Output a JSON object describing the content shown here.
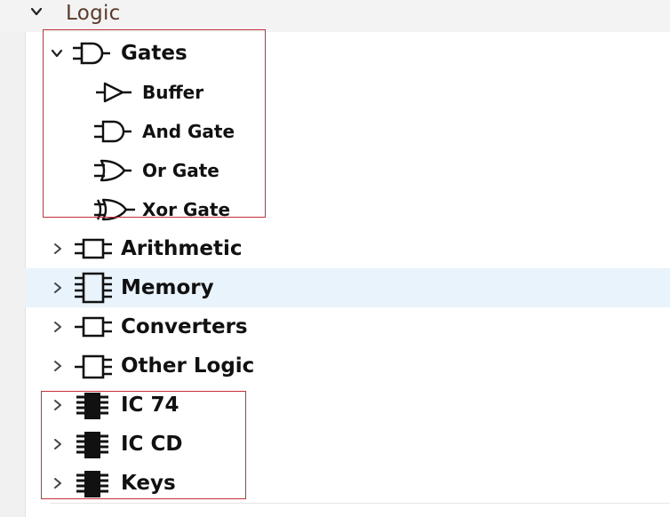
{
  "tree": {
    "category": {
      "label": "Logic",
      "expanded": true
    },
    "groups": [
      {
        "id": "gates",
        "label": "Gates",
        "icon": "and-gate-icon",
        "expanded": true,
        "children": [
          {
            "label": "Buffer",
            "icon": "buffer-icon"
          },
          {
            "label": "And Gate",
            "icon": "and-gate-icon"
          },
          {
            "label": "Or Gate",
            "icon": "or-gate-icon"
          },
          {
            "label": "Xor Gate",
            "icon": "xor-gate-icon"
          }
        ]
      },
      {
        "id": "arithmetic",
        "label": "Arithmetic",
        "icon": "arithmetic-block-icon",
        "expanded": false
      },
      {
        "id": "memory",
        "label": "Memory",
        "icon": "memory-block-icon",
        "expanded": false,
        "selected": true
      },
      {
        "id": "converters",
        "label": "Converters",
        "icon": "converter-block-icon",
        "expanded": false
      },
      {
        "id": "other_logic",
        "label": "Other Logic",
        "icon": "other-logic-block-icon",
        "expanded": false
      },
      {
        "id": "ic74",
        "label": "IC 74",
        "icon": "ic-chip-icon",
        "expanded": false
      },
      {
        "id": "iccd",
        "label": "IC CD",
        "icon": "ic-chip-icon",
        "expanded": false
      },
      {
        "id": "keys",
        "label": "Keys",
        "icon": "ic-chip-icon",
        "expanded": false
      }
    ]
  },
  "colors": {
    "selection": "#e9f3fc",
    "highlight_border": "#c62f3c",
    "category_text": "#5a3b2b"
  }
}
